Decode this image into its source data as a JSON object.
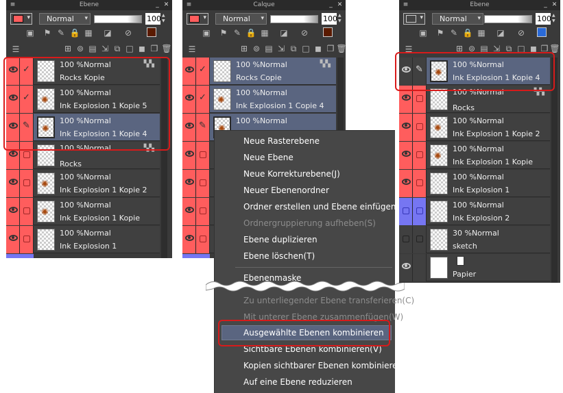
{
  "panels": [
    {
      "title": "Ebene",
      "blend_mode": "Normal",
      "opacity": "100",
      "layers": [
        {
          "opacity_mode": "100 %Normal",
          "name": "Rocks Kopie"
        },
        {
          "opacity_mode": "100 %Normal",
          "name": "Ink Explosion 1 Kopie 5"
        },
        {
          "opacity_mode": "100 %Normal",
          "name": "Ink Explosion 1 Kopie 4"
        },
        {
          "opacity_mode": "100 %Normal",
          "name": "Rocks"
        },
        {
          "opacity_mode": "100 %Normal",
          "name": "Ink Explosion 1 Kopie 2"
        },
        {
          "opacity_mode": "100 %Normal",
          "name": "Ink Explosion 1 Kopie"
        },
        {
          "opacity_mode": "100 %Normal",
          "name": "Ink Explosion 1"
        }
      ]
    },
    {
      "title": "Calque",
      "blend_mode": "Normal",
      "opacity": "100",
      "layers": [
        {
          "opacity_mode": "100 %Normal",
          "name": "Rocks Copie"
        },
        {
          "opacity_mode": "100 %Normal",
          "name": "Ink Explosion 1 Copie 4"
        },
        {
          "opacity_mode": "100 %Normal",
          "name": ""
        }
      ]
    },
    {
      "title": "Ebene",
      "blend_mode": "Normal",
      "opacity": "100",
      "layers": [
        {
          "opacity_mode": "100 %Normal",
          "name": "Ink Explosion 1 Kopie 4"
        },
        {
          "opacity_mode": "100 %Normal",
          "name": "Rocks"
        },
        {
          "opacity_mode": "100 %Normal",
          "name": "Ink Explosion 1 Kopie 2"
        },
        {
          "opacity_mode": "100 %Normal",
          "name": "Ink Explosion 1 Kopie"
        },
        {
          "opacity_mode": "100 %Normal",
          "name": "Ink Explosion 1"
        },
        {
          "opacity_mode": "100 %Normal",
          "name": "Ink Explosion 2"
        },
        {
          "opacity_mode": "30 %Normal",
          "name": "sketch"
        },
        {
          "opacity_mode": "",
          "name": "Papier"
        }
      ]
    }
  ],
  "context_menu": {
    "items": [
      {
        "label": "Neue Rasterebene",
        "enabled": true
      },
      {
        "label": "Neue Ebene",
        "enabled": true
      },
      {
        "label": "Neue Korrekturebene(J)",
        "enabled": true
      },
      {
        "label": "Neuer Ebenenordner",
        "enabled": true
      },
      {
        "label": "Ordner erstellen und Ebene einfügen",
        "enabled": true
      },
      {
        "label": "Ordnergruppierung aufheben(S)",
        "enabled": false
      },
      {
        "label": "Ebene duplizieren",
        "enabled": true
      },
      {
        "label": "Ebene löschen(T)",
        "enabled": true
      },
      {
        "label": "Ebenenmaske",
        "enabled": true
      },
      {
        "label": "Zu unterliegender Ebene transferieren(C)",
        "enabled": false
      },
      {
        "label": "Mit unterer Ebene zusammenfügen(W)",
        "enabled": false
      },
      {
        "label": "Ausgewählte Ebenen kombinieren",
        "enabled": true
      },
      {
        "label": "Sichtbare Ebenen kombinieren(V)",
        "enabled": true
      },
      {
        "label": "Kopien sichtbarer Ebenen kombinieren(X)",
        "enabled": true
      },
      {
        "label": "Auf eine Ebene reduzieren",
        "enabled": true
      }
    ]
  },
  "colors": {
    "visible_column": "#ff5d5d",
    "blue_column": "#7676f2",
    "selected_layer": "#5a6580",
    "highlight_box": "#d81a1a",
    "panel_bg": "#3a3a3a",
    "menu_bg": "#474747"
  }
}
